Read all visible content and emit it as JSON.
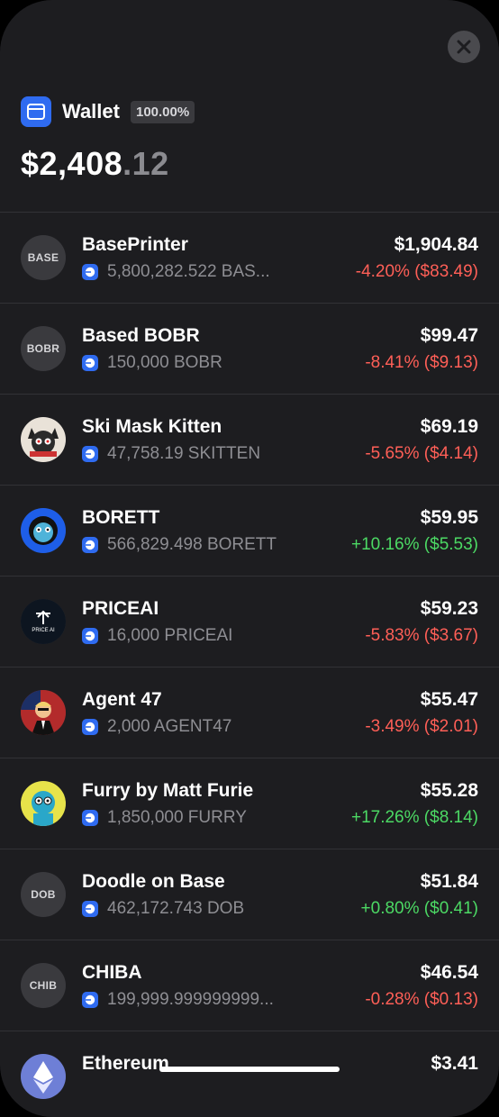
{
  "header": {
    "title": "Wallet",
    "percent": "100.00%",
    "balance_main": "$2,408",
    "balance_cents": ".12"
  },
  "tokens": [
    {
      "name": "BasePrinter",
      "avatar_text": "BASE",
      "avatar_type": "text",
      "amount": "5,800,282.522 BAS...",
      "value": "$1,904.84",
      "change": "-4.20% ($83.49)",
      "direction": "down"
    },
    {
      "name": "Based BOBR",
      "avatar_text": "BOBR",
      "avatar_type": "text",
      "amount": "150,000 BOBR",
      "value": "$99.47",
      "change": "-8.41% ($9.13)",
      "direction": "down"
    },
    {
      "name": "Ski Mask Kitten",
      "avatar_text": "",
      "avatar_type": "kitten",
      "amount": "47,758.19 SKITTEN",
      "value": "$69.19",
      "change": "-5.65% ($4.14)",
      "direction": "down"
    },
    {
      "name": "BORETT",
      "avatar_text": "",
      "avatar_type": "borett",
      "amount": "566,829.498 BORETT",
      "value": "$59.95",
      "change": "+10.16% ($5.53)",
      "direction": "up"
    },
    {
      "name": "PRICEAI",
      "avatar_text": "PRICE AI",
      "avatar_type": "priceai",
      "amount": "16,000 PRICEAI",
      "value": "$59.23",
      "change": "-5.83% ($3.67)",
      "direction": "down"
    },
    {
      "name": "Agent 47",
      "avatar_text": "",
      "avatar_type": "agent",
      "amount": "2,000 AGENT47",
      "value": "$55.47",
      "change": "-3.49% ($2.01)",
      "direction": "down"
    },
    {
      "name": "Furry by Matt Furie",
      "avatar_text": "",
      "avatar_type": "furry",
      "amount": "1,850,000 FURRY",
      "value": "$55.28",
      "change": "+17.26% ($8.14)",
      "direction": "up"
    },
    {
      "name": "Doodle on Base",
      "avatar_text": "DOB",
      "avatar_type": "text",
      "amount": "462,172.743 DOB",
      "value": "$51.84",
      "change": "+0.80% ($0.41)",
      "direction": "up"
    },
    {
      "name": "CHIBA",
      "avatar_text": "CHIB",
      "avatar_type": "text",
      "amount": "199,999.999999999...",
      "value": "$46.54",
      "change": "-0.28% ($0.13)",
      "direction": "down"
    },
    {
      "name": "Ethereum",
      "avatar_text": "",
      "avatar_type": "eth",
      "amount": "",
      "value": "$3.41",
      "change": "",
      "direction": "none"
    }
  ],
  "colors": {
    "background": "#1d1d20",
    "accent": "#2f6bf0",
    "negative": "#ff5f57",
    "positive": "#4cd964"
  },
  "icons": {
    "close": "close-icon",
    "wallet": "wallet-icon",
    "chain": "base-chain-icon"
  }
}
